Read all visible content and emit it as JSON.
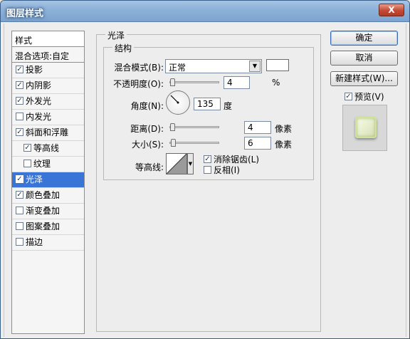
{
  "window": {
    "title": "图层样式",
    "close_label": "X"
  },
  "styles": {
    "header": "样式",
    "blend": "混合选项:自定",
    "items": [
      {
        "label": "投影",
        "checked": true
      },
      {
        "label": "内阴影",
        "checked": true
      },
      {
        "label": "外发光",
        "checked": true
      },
      {
        "label": "内发光",
        "checked": false
      },
      {
        "label": "斜面和浮雕",
        "checked": true
      },
      {
        "label": "等高线",
        "checked": true
      },
      {
        "label": "纹理",
        "checked": false
      },
      {
        "label": "光泽",
        "checked": true
      },
      {
        "label": "颜色叠加",
        "checked": true
      },
      {
        "label": "渐变叠加",
        "checked": false
      },
      {
        "label": "图案叠加",
        "checked": false
      },
      {
        "label": "描边",
        "checked": false
      }
    ]
  },
  "satin": {
    "title": "光泽",
    "structure_title": "结构",
    "blend_mode_label": "混合模式(B):",
    "blend_mode_value": "正常",
    "opacity_label": "不透明度(O):",
    "opacity_value": "4",
    "opacity_unit": "%",
    "angle_label": "角度(N):",
    "angle_value": "135",
    "angle_unit": "度",
    "distance_label": "距离(D):",
    "distance_value": "4",
    "distance_unit": "像素",
    "size_label": "大小(S):",
    "size_value": "6",
    "size_unit": "像素",
    "contour_label": "等高线:",
    "antialias_label": "消除锯齿(L)",
    "antialias_checked": true,
    "invert_label": "反相(I)",
    "invert_checked": false
  },
  "buttons": {
    "ok": "确定",
    "cancel": "取消",
    "new_style": "新建样式(W)...",
    "preview_label": "预览(V)",
    "preview_checked": true
  },
  "colors": {
    "selection": "#3875d7",
    "title_text": "#ffffff",
    "close": "#c34a35"
  }
}
